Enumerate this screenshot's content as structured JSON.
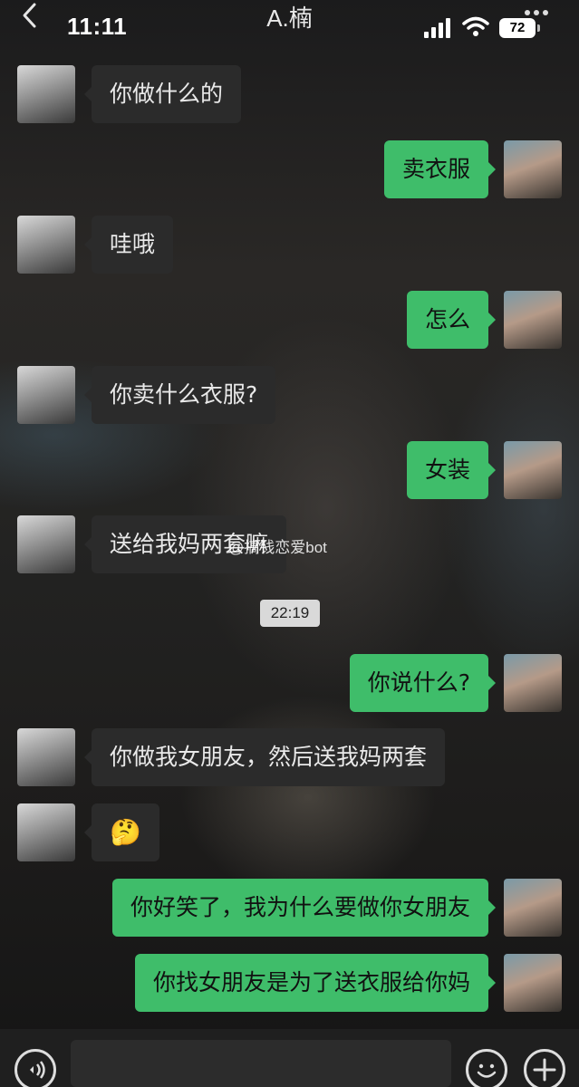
{
  "status_bar": {
    "time": "11:11",
    "battery": "72",
    "icons": [
      "signal-icon",
      "wifi-icon",
      "battery-icon"
    ]
  },
  "header": {
    "title": "A.楠",
    "back_icon": "chevron-left-icon",
    "more_icon": "more-dots-icon"
  },
  "messages": [
    {
      "side": "left",
      "text": "你做什么的"
    },
    {
      "side": "right",
      "text": "卖衣服"
    },
    {
      "side": "left",
      "text": "哇哦"
    },
    {
      "side": "right",
      "text": "怎么"
    },
    {
      "side": "left",
      "text": "你卖什么衣服?"
    },
    {
      "side": "right",
      "text": "女装"
    },
    {
      "side": "left",
      "text": "送给我妈两套嘛"
    },
    {
      "side": "right",
      "text": "你说什么?"
    },
    {
      "side": "left",
      "text": "你做我女朋友，然后送我妈两套"
    },
    {
      "side": "left",
      "text": "🤔"
    },
    {
      "side": "right",
      "text": "你好笑了，我为什么要做你女朋友"
    },
    {
      "side": "right",
      "text": "你找女朋友是为了送衣服给你妈"
    }
  ],
  "timestamp": "22:19",
  "watermark": "@搞钱恋爱bot",
  "input_bar": {
    "icons": [
      "voice-icon",
      "emoji-icon",
      "plus-icon"
    ],
    "placeholder": ""
  },
  "colors": {
    "outgoing_bubble": "#3fbd6a",
    "incoming_bubble": "#2b2b2b",
    "timestamp_bg": "#d9d9d9"
  }
}
